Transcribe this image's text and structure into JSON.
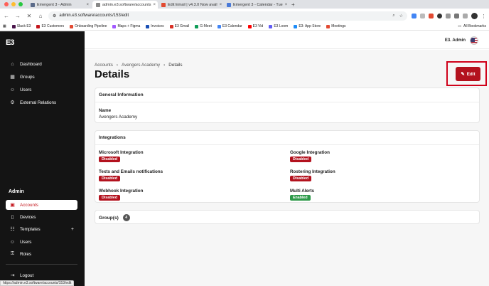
{
  "browser": {
    "tabs": [
      {
        "label": "Emergent 3 - Admin",
        "color": "#5b6b8a"
      },
      {
        "label": "admin.e3.software/accounts",
        "color": "#888888",
        "active": true
      },
      {
        "label": "Edit Email | v4.3.0 Now avail",
        "color": "#e24a32"
      },
      {
        "label": "Emergent 3 - Calendar - Tue",
        "color": "#4a7ad8"
      }
    ],
    "url": "admin.e3.software/accounts/153/edit",
    "bookmarks": [
      {
        "label": "Slack E3",
        "color": "#4a154b"
      },
      {
        "label": "E3 Customers",
        "color": "#c4161c"
      },
      {
        "label": "Onboarding Pipeline",
        "color": "#e24a32"
      },
      {
        "label": "Maps + Figma",
        "color": "#a259ff"
      },
      {
        "label": "Invoices",
        "color": "#1a4fb4"
      },
      {
        "label": "E3 Gmail",
        "color": "#d93025"
      },
      {
        "label": "G-Meet",
        "color": "#0f9d58"
      },
      {
        "label": "E3 Calendar",
        "color": "#4285f4"
      },
      {
        "label": "E3 Vid",
        "color": "#ff0000"
      },
      {
        "label": "E3 Loom",
        "color": "#625df5"
      },
      {
        "label": "E3: App Store",
        "color": "#1d8cf8"
      },
      {
        "label": "Meetings",
        "color": "#e24a32"
      }
    ],
    "all_bookmarks": "All Bookmarks",
    "status_url": "https://admin.e3.software/accounts/153/edit"
  },
  "sidebar": {
    "logo": "E3",
    "main_items": [
      {
        "label": "Dashboard",
        "icon": "home-icon"
      },
      {
        "label": "Groups",
        "icon": "grid-icon"
      },
      {
        "label": "Users",
        "icon": "users-icon"
      },
      {
        "label": "External Relations",
        "icon": "gear-icon"
      }
    ],
    "admin_heading": "Admin",
    "admin_items": [
      {
        "label": "Accounts",
        "icon": "building-icon",
        "active": true
      },
      {
        "label": "Devices",
        "icon": "phone-icon"
      },
      {
        "label": "Templates",
        "icon": "template-icon",
        "plus": "+"
      },
      {
        "label": "Users",
        "icon": "users-icon"
      },
      {
        "label": "Roles",
        "icon": "key-icon"
      }
    ],
    "logout": "Logout"
  },
  "topbar": {
    "user_name": "E3. Admin"
  },
  "page": {
    "breadcrumb": [
      "Accounts",
      "Avengers Academy",
      "Details"
    ],
    "title": "Details",
    "edit_label": "Edit"
  },
  "general": {
    "header": "General Information",
    "name_label": "Name",
    "name_value": "Avengers Academy"
  },
  "integrations": {
    "header": "Integrations",
    "items": [
      {
        "label": "Microsoft Integration",
        "status": "Disabled"
      },
      {
        "label": "Google Integration",
        "status": "Disabled"
      },
      {
        "label": "Texts and Emails notifications",
        "status": "Disabled"
      },
      {
        "label": "Rostering Integration",
        "status": "Disabled"
      },
      {
        "label": "Webhook Integration",
        "status": "Disabled"
      },
      {
        "label": "Multi Alerts",
        "status": "Enabled"
      }
    ]
  },
  "groups": {
    "label": "Group(s)",
    "count": "4"
  },
  "colors": {
    "accent": "#b3121e",
    "sidebar_bg": "#141414",
    "enabled": "#2e9a4a",
    "disabled": "#b3121e"
  }
}
